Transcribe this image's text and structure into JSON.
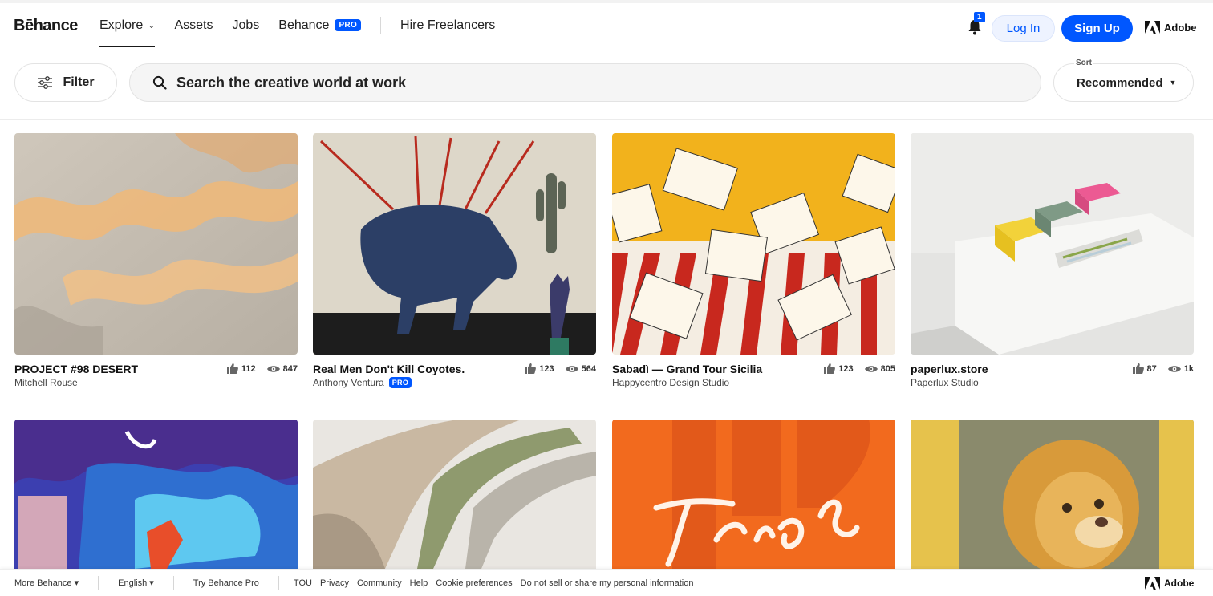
{
  "header": {
    "logo": "Bēhance",
    "nav": [
      {
        "label": "Explore",
        "dropdown": true
      },
      {
        "label": "Assets"
      },
      {
        "label": "Jobs"
      },
      {
        "label": "Behance",
        "badge": "PRO"
      },
      {
        "label": "Hire Freelancers"
      }
    ],
    "notification_count": "1",
    "login_label": "Log In",
    "signup_label": "Sign Up",
    "adobe_label": "Adobe"
  },
  "search": {
    "filter_label": "Filter",
    "placeholder": "Search the creative world at work",
    "sort_label": "Sort",
    "sort_value": "Recommended"
  },
  "projects": [
    {
      "title": "PROJECT #98 DESERT",
      "owner": "Mitchell Rouse",
      "likes": "112",
      "views": "847"
    },
    {
      "title": "Real Men Don't Kill Coyotes.",
      "owner": "Anthony Ventura",
      "owner_badge": "PRO",
      "likes": "123",
      "views": "564"
    },
    {
      "title": "Sabadì — Grand Tour Sicilia",
      "owner": "Happycentro Design Studio",
      "likes": "123",
      "views": "805"
    },
    {
      "title": "paperlux.store",
      "owner": "Paperlux Studio",
      "likes": "87",
      "views": "1k"
    }
  ],
  "footer": {
    "more": "More Behance ▾",
    "language": "English ▾",
    "try_pro": "Try Behance Pro",
    "links": [
      "TOU",
      "Privacy",
      "Community",
      "Help",
      "Cookie preferences",
      "Do not sell or share my personal information"
    ],
    "adobe_label": "Adobe"
  },
  "colors": {
    "accent": "#0057ff"
  }
}
